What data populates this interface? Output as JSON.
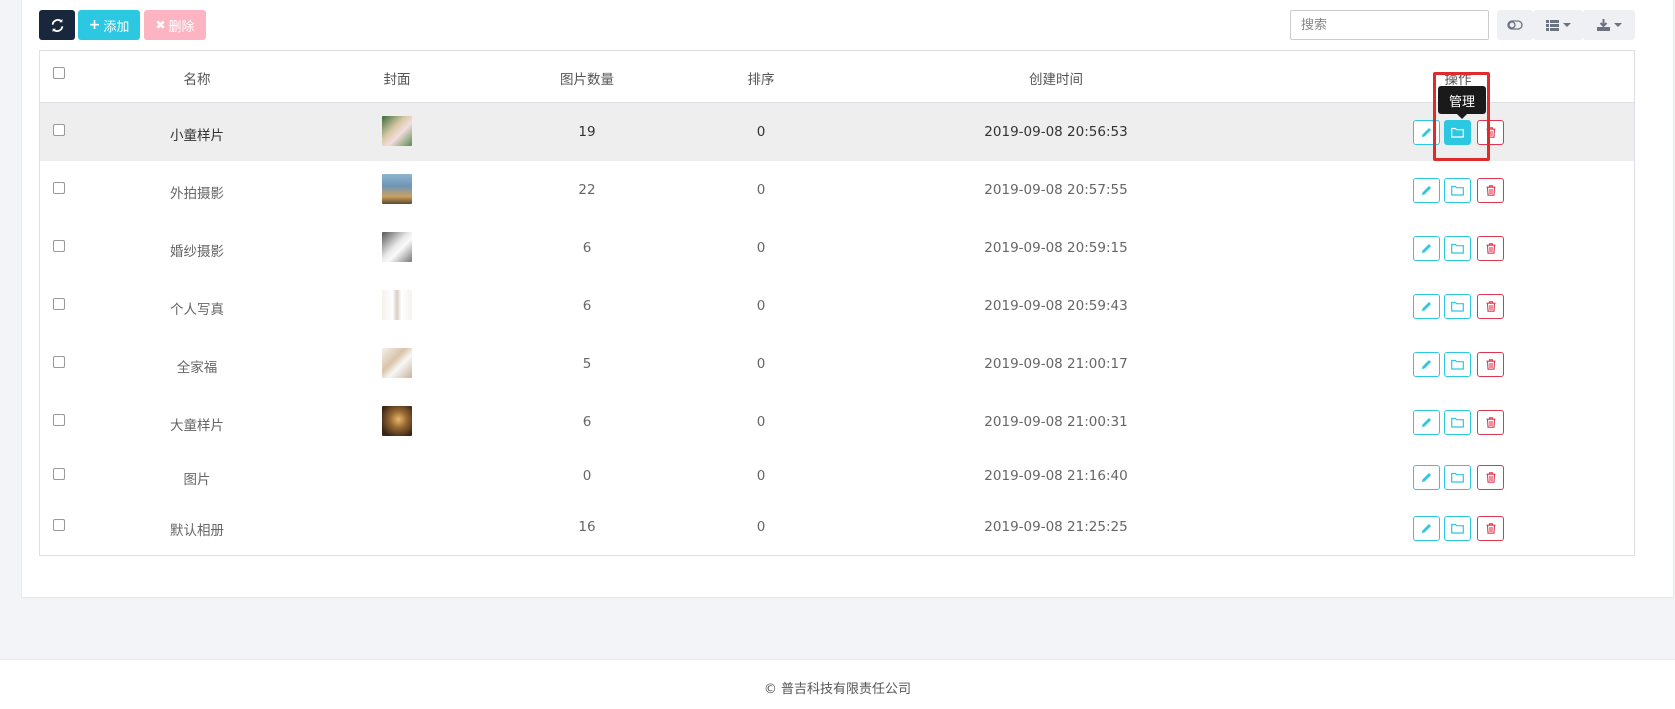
{
  "toolbar": {
    "refresh_icon": "refresh-icon",
    "add_label": "添加",
    "delete_label": "删除",
    "search_placeholder": "搜索"
  },
  "colors": {
    "primary": "#2cc7e0",
    "dark": "#19273c",
    "danger": "#e0364f",
    "danger_light": "#fcb4c3",
    "highlight": "#e02b2b"
  },
  "table": {
    "headers": {
      "name": "名称",
      "cover": "封面",
      "count": "图片数量",
      "sort": "排序",
      "created": "创建时间",
      "actions": "操作"
    },
    "rows": [
      {
        "name": "小童样片",
        "cover": "photo",
        "count": "19",
        "sort": "0",
        "created": "2019-09-08 20:56:53"
      },
      {
        "name": "外拍摄影",
        "cover": "photo",
        "count": "22",
        "sort": "0",
        "created": "2019-09-08 20:57:55"
      },
      {
        "name": "婚纱摄影",
        "cover": "photo",
        "count": "6",
        "sort": "0",
        "created": "2019-09-08 20:59:15"
      },
      {
        "name": "个人写真",
        "cover": "photo",
        "count": "6",
        "sort": "0",
        "created": "2019-09-08 20:59:43"
      },
      {
        "name": "全家福",
        "cover": "photo",
        "count": "5",
        "sort": "0",
        "created": "2019-09-08 21:00:17"
      },
      {
        "name": "大童样片",
        "cover": "photo",
        "count": "6",
        "sort": "0",
        "created": "2019-09-08 21:00:31"
      },
      {
        "name": "图片",
        "cover": "",
        "count": "0",
        "sort": "0",
        "created": "2019-09-08 21:16:40"
      },
      {
        "name": "默认相册",
        "cover": "",
        "count": "16",
        "sort": "0",
        "created": "2019-09-08 21:25:25"
      }
    ]
  },
  "tooltip": {
    "label": "管理"
  },
  "footer": {
    "copyright": "© 普吉科技有限责任公司"
  }
}
